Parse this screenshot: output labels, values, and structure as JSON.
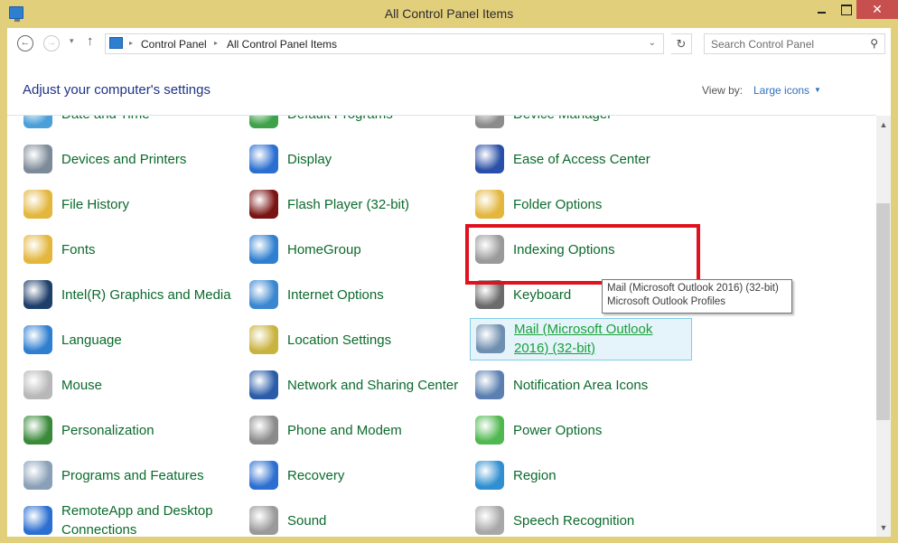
{
  "window": {
    "title": "All Control Panel Items",
    "minimize_label": "",
    "maximize_label": "",
    "close_label": "✕"
  },
  "navbar": {
    "back_icon": "←",
    "forward_icon": "→",
    "recent_icon": "▾",
    "up_icon": "↑",
    "breadcrumbs": [
      "Control Panel",
      "All Control Panel Items"
    ],
    "crumb_separator": "▸",
    "address_dropdown_icon": "⌄",
    "refresh_icon": "↻",
    "search_placeholder": "Search Control Panel",
    "search_icon": "⚲"
  },
  "header": {
    "title": "Adjust your computer's settings",
    "view_by_label": "View by:",
    "view_by_value": "Large icons",
    "view_by_arrow": "▼"
  },
  "items": [
    {
      "label": "Date and Time",
      "icon": "calendar-clock-icon",
      "color": "#4a9fd8"
    },
    {
      "label": "Default Programs",
      "icon": "default-programs-icon",
      "color": "#3fa14a"
    },
    {
      "label": "Device Manager",
      "icon": "device-manager-icon",
      "color": "#8c8c8c"
    },
    {
      "label": "Devices and Printers",
      "icon": "printer-icon",
      "color": "#7d8a99"
    },
    {
      "label": "Display",
      "icon": "display-icon",
      "color": "#2c6fd1"
    },
    {
      "label": "Ease of Access Center",
      "icon": "ease-of-access-icon",
      "color": "#2a4fa8"
    },
    {
      "label": "File History",
      "icon": "file-history-icon",
      "color": "#e3b63d"
    },
    {
      "label": "Flash Player (32-bit)",
      "icon": "flash-player-icon",
      "color": "#7a1414"
    },
    {
      "label": "Folder Options",
      "icon": "folder-options-icon",
      "color": "#e3b63d"
    },
    {
      "label": "Fonts",
      "icon": "fonts-icon",
      "color": "#e3b63d"
    },
    {
      "label": "HomeGroup",
      "icon": "homegroup-icon",
      "color": "#2f7fd0"
    },
    {
      "label": "Indexing Options",
      "icon": "indexing-options-icon",
      "color": "#9a9a9a"
    },
    {
      "label": "Intel(R) Graphics and Media",
      "icon": "intel-graphics-icon",
      "color": "#1f3f6b"
    },
    {
      "label": "Internet Options",
      "icon": "internet-options-icon",
      "color": "#3a86cf"
    },
    {
      "label": "Keyboard",
      "icon": "keyboard-icon",
      "color": "#6b6b6b"
    },
    {
      "label": "Language",
      "icon": "language-icon",
      "color": "#2f7fd0"
    },
    {
      "label": "Location Settings",
      "icon": "location-settings-icon",
      "color": "#c9b33f"
    },
    {
      "label": "Mail (Microsoft Outlook 2016) (32-bit)",
      "icon": "mail-icon",
      "color": "#6f8fb0"
    },
    {
      "label": "Mouse",
      "icon": "mouse-icon",
      "color": "#b8b8b8"
    },
    {
      "label": "Network and Sharing Center",
      "icon": "network-icon",
      "color": "#2a5ca8"
    },
    {
      "label": "Notification Area Icons",
      "icon": "notification-area-icon",
      "color": "#5a7fb0"
    },
    {
      "label": "Personalization",
      "icon": "personalization-icon",
      "color": "#3a8a3a"
    },
    {
      "label": "Phone and Modem",
      "icon": "phone-modem-icon",
      "color": "#8a8a8a"
    },
    {
      "label": "Power Options",
      "icon": "power-options-icon",
      "color": "#4fb84f"
    },
    {
      "label": "Programs and Features",
      "icon": "programs-features-icon",
      "color": "#8aa0b8"
    },
    {
      "label": "Recovery",
      "icon": "recovery-icon",
      "color": "#2c6fd1"
    },
    {
      "label": "Region",
      "icon": "region-icon",
      "color": "#2f8fd0"
    },
    {
      "label": "RemoteApp and Desktop Connections",
      "icon": "remoteapp-icon",
      "color": "#2c6fd1"
    },
    {
      "label": "Sound",
      "icon": "sound-icon",
      "color": "#9a9a9a"
    },
    {
      "label": "Speech Recognition",
      "icon": "microphone-icon",
      "color": "#a8a8a8"
    }
  ],
  "tooltip": {
    "line1": "Mail (Microsoft Outlook 2016) (32-bit)",
    "line2": "Microsoft Outlook Profiles"
  },
  "scrollbar": {
    "up_icon": "▲",
    "down_icon": "▼"
  }
}
